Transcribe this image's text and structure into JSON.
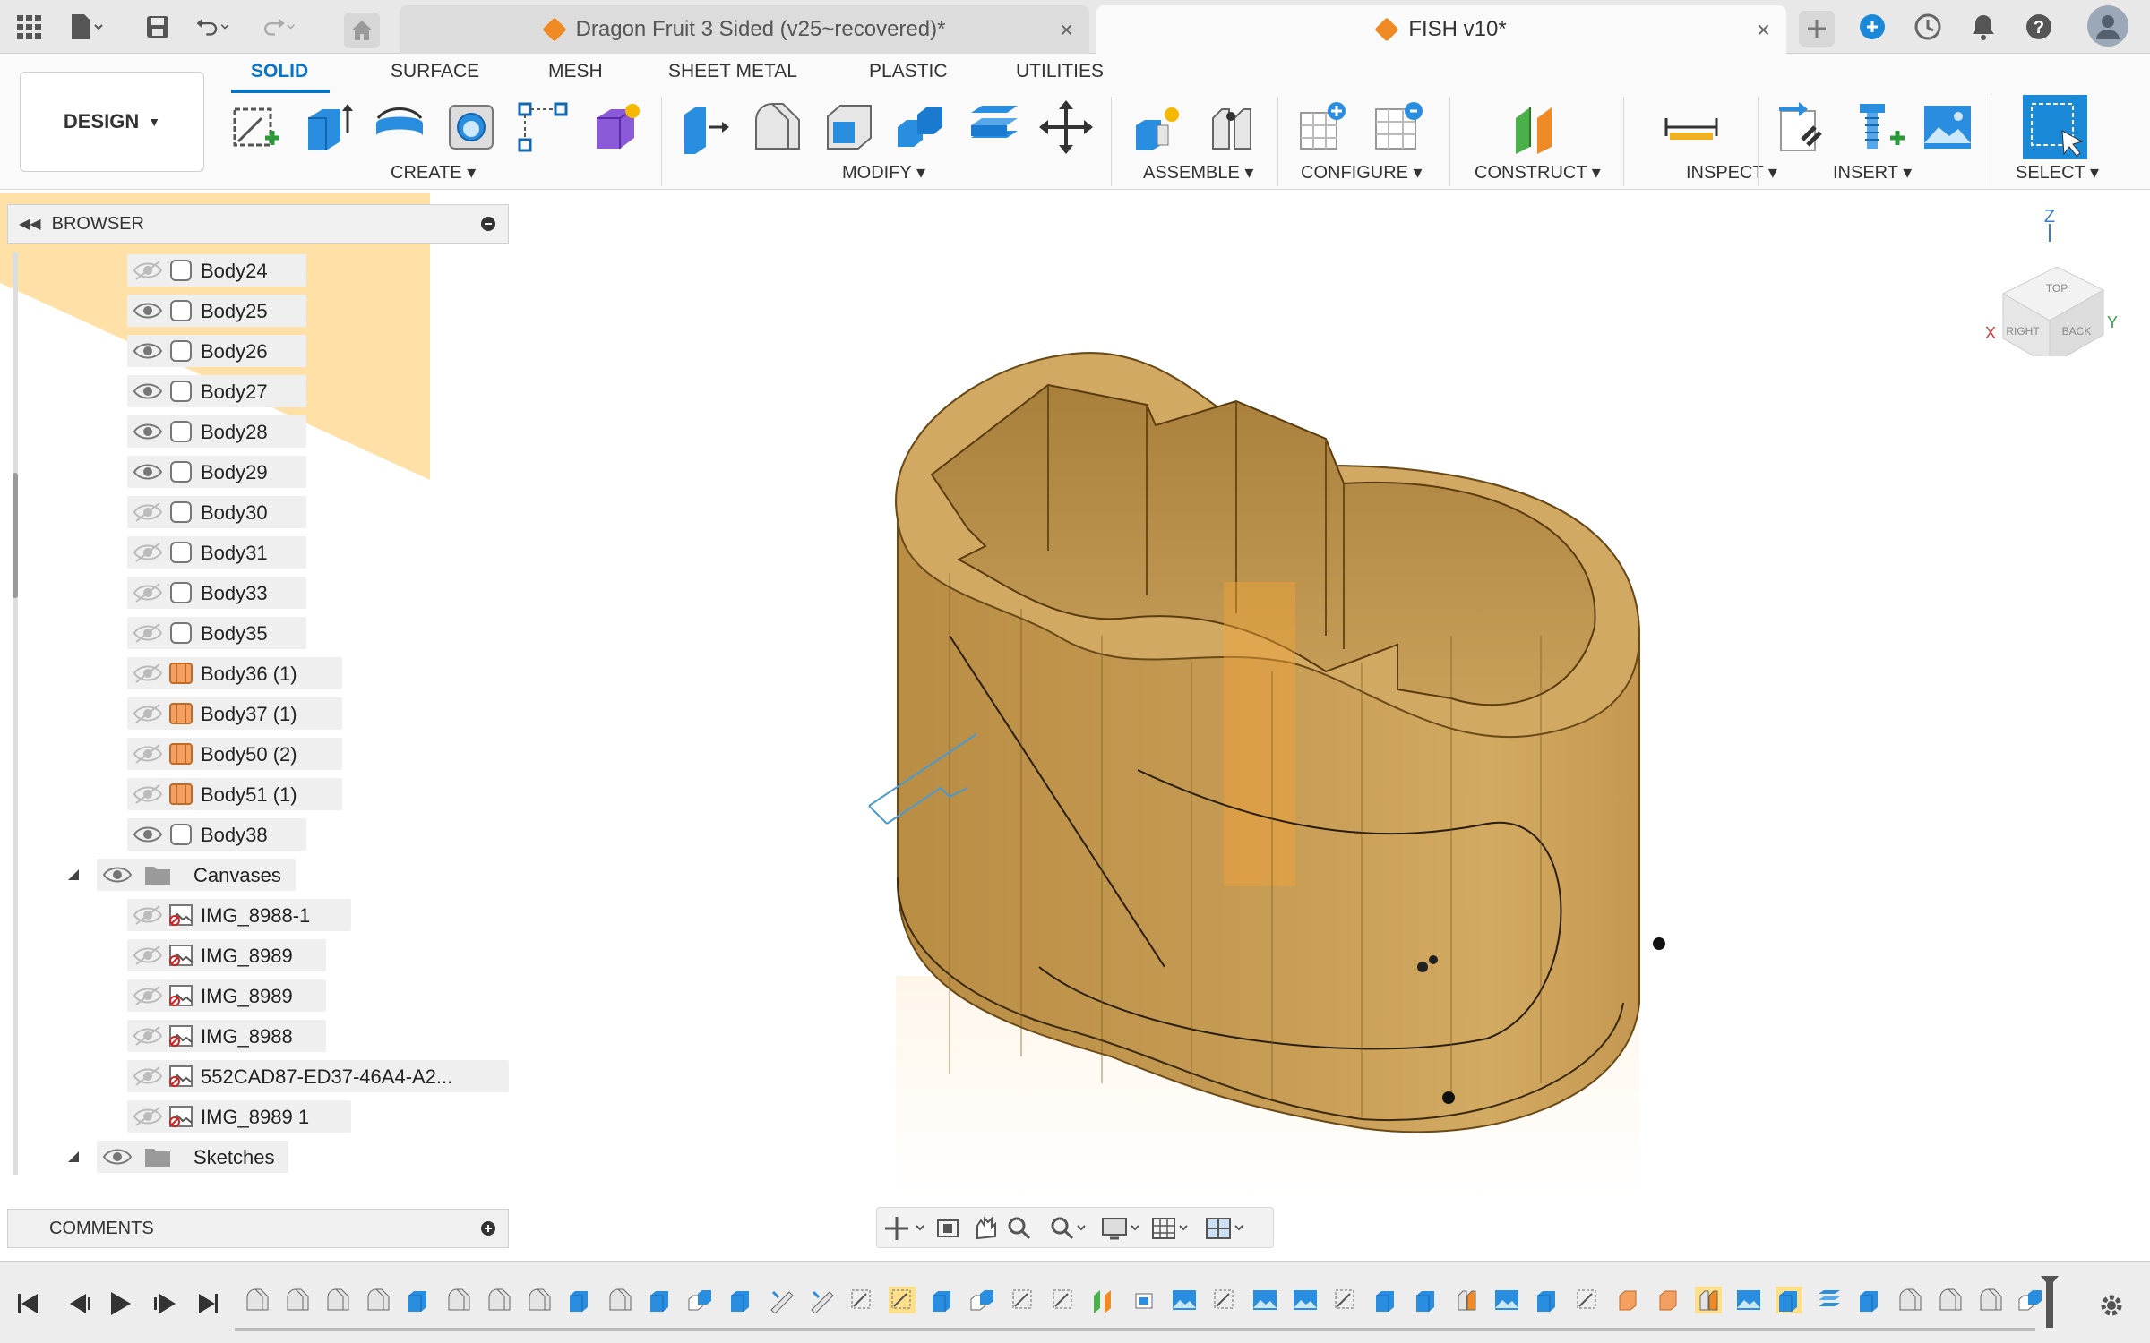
{
  "tabs": {
    "doc1": "Dragon Fruit 3 Sided (v25~recovered)*",
    "doc2": "FISH v10*"
  },
  "ribbon": {
    "workspace": "DESIGN",
    "tabs": [
      "SOLID",
      "SURFACE",
      "MESH",
      "SHEET METAL",
      "PLASTIC",
      "UTILITIES"
    ],
    "groups": [
      "CREATE",
      "MODIFY",
      "ASSEMBLE",
      "CONFIGURE",
      "CONSTRUCT",
      "INSPECT",
      "INSERT",
      "SELECT"
    ]
  },
  "browser": {
    "title": "BROWSER",
    "bodies": [
      {
        "label": "Body24",
        "visible": false,
        "kind": "body"
      },
      {
        "label": "Body25",
        "visible": true,
        "kind": "body"
      },
      {
        "label": "Body26",
        "visible": true,
        "kind": "body"
      },
      {
        "label": "Body27",
        "visible": true,
        "kind": "body"
      },
      {
        "label": "Body28",
        "visible": true,
        "kind": "body"
      },
      {
        "label": "Body29",
        "visible": true,
        "kind": "body"
      },
      {
        "label": "Body30",
        "visible": false,
        "kind": "body"
      },
      {
        "label": "Body31",
        "visible": false,
        "kind": "body"
      },
      {
        "label": "Body33",
        "visible": false,
        "kind": "body"
      },
      {
        "label": "Body35",
        "visible": false,
        "kind": "body"
      },
      {
        "label": "Body36 (1)",
        "visible": false,
        "kind": "component"
      },
      {
        "label": "Body37 (1)",
        "visible": false,
        "kind": "component"
      },
      {
        "label": "Body50 (2)",
        "visible": false,
        "kind": "component"
      },
      {
        "label": "Body51 (1)",
        "visible": false,
        "kind": "component"
      },
      {
        "label": "Body38",
        "visible": true,
        "kind": "body"
      }
    ],
    "canvases_folder": "Canvases",
    "canvases": [
      {
        "label": "IMG_8988-1",
        "visible": false
      },
      {
        "label": "IMG_8989",
        "visible": false
      },
      {
        "label": "IMG_8989",
        "visible": false
      },
      {
        "label": "IMG_8988",
        "visible": false
      },
      {
        "label": "552CAD87-ED37-46A4-A2...",
        "visible": false
      },
      {
        "label": "IMG_8989 1",
        "visible": false
      }
    ],
    "sketches_folder": "Sketches"
  },
  "comments": {
    "title": "COMMENTS"
  },
  "viewcube": {
    "top": "TOP",
    "right": "RIGHT",
    "back": "BACK",
    "z": "Z",
    "x": "X",
    "y": "Y"
  },
  "colors": {
    "accent": "#0a74c4",
    "body": "#c9a25a",
    "highlight": "#ffe08a"
  }
}
